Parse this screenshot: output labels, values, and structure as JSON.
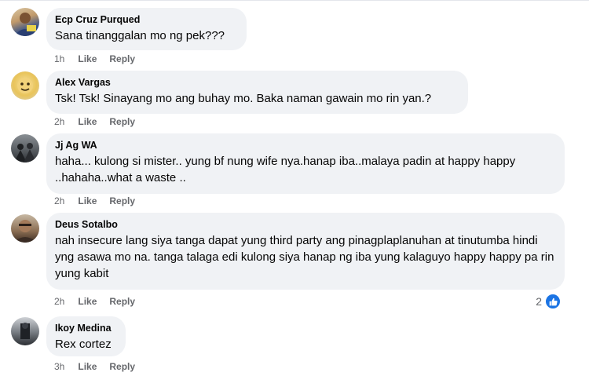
{
  "actions": {
    "like": "Like",
    "reply": "Reply"
  },
  "comments": [
    {
      "author": "Ecp Cruz Purqued",
      "text": "Sana tinanggalan mo ng pek???",
      "time": "1h"
    },
    {
      "author": "Alex Vargas",
      "text": "Tsk! Tsk! Sinayang mo ang buhay mo. Baka naman gawain mo rin yan.?",
      "time": "2h"
    },
    {
      "author": "Jj Ag WA",
      "text": "haha... kulong si mister.. yung bf nung wife nya.hanap iba..malaya padin at happy happy ..hahaha..what a waste ..",
      "time": "2h"
    },
    {
      "author": "Deus Sotalbo",
      "text": "nah insecure lang siya tanga dapat yung third party ang pinagplaplanuhan at tinutumba hindi yng asawa mo na. tanga talaga edi kulong siya hanap ng iba yung kalaguyo happy happy pa rin yung kabit",
      "time": "2h",
      "reaction_count": "2"
    },
    {
      "author": "Ikoy Medina",
      "text": "Rex cortez",
      "time": "3h"
    }
  ],
  "colors": {
    "bubble": "#f0f2f5",
    "meta": "#65676b",
    "like_blue": "#1b74e4"
  },
  "icons": {
    "reaction": "thumbs-up-icon"
  }
}
